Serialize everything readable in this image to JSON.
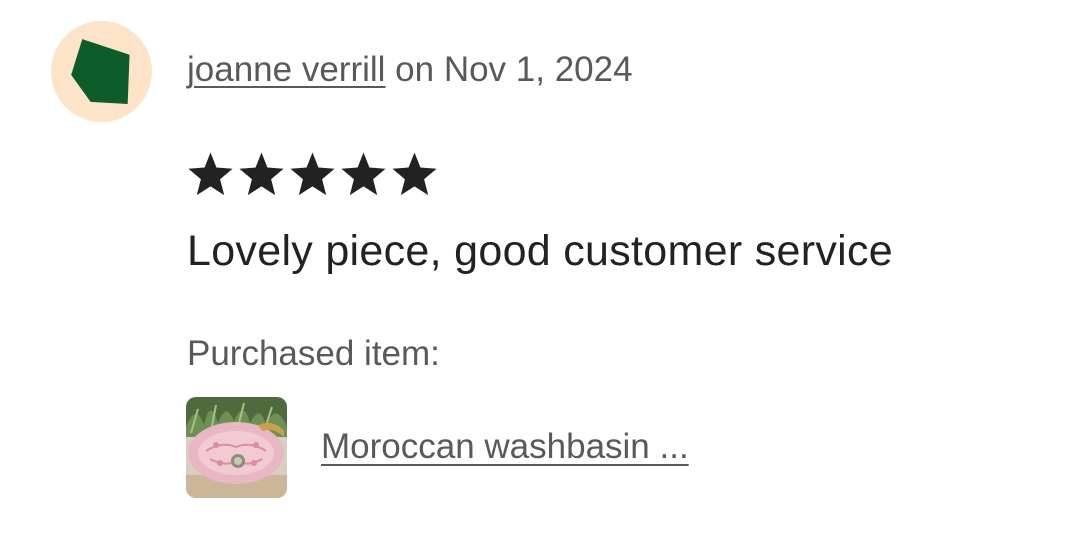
{
  "review": {
    "reviewer_name": "joanne verrill",
    "date_text": " on Nov 1, 2024",
    "rating": 5,
    "rating_max": 5,
    "text": "Lovely piece, good customer service"
  },
  "purchase": {
    "label": "Purchased item:",
    "item_title": "Moroccan washbasin ..."
  },
  "colors": {
    "avatar_bg": "#fde3c8",
    "avatar_shape": "#0e5c2a",
    "star": "#222222",
    "muted_text": "#595959"
  },
  "icons": {
    "avatar": "green-pentagon-avatar-icon",
    "star": "star-filled-icon"
  }
}
